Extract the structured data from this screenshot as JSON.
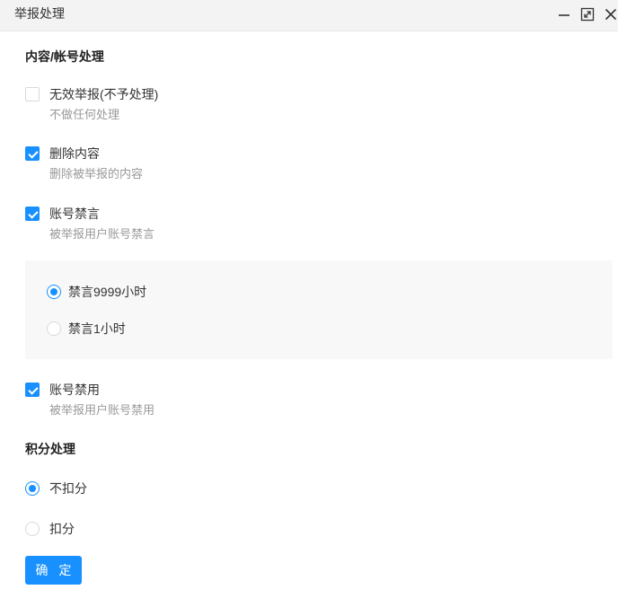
{
  "window": {
    "title": "举报处理",
    "controls": [
      "minimize-icon",
      "maximize-icon",
      "close-icon"
    ]
  },
  "content_section": {
    "title": "内容/帐号处理",
    "options": [
      {
        "label": "无效举报(不予处理)",
        "description": "不做任何处理",
        "checked": false
      },
      {
        "label": "删除内容",
        "description": "删除被举报的内容",
        "checked": true
      },
      {
        "label": "账号禁言",
        "description": "被举报用户账号禁言",
        "checked": true
      },
      {
        "label": "账号禁用",
        "description": "被举报用户账号禁用",
        "checked": true
      }
    ],
    "mute_duration": [
      {
        "label": "禁言9999小时",
        "selected": true
      },
      {
        "label": "禁言1小时",
        "selected": false
      }
    ]
  },
  "points_section": {
    "title": "积分处理",
    "options": [
      {
        "label": "不扣分",
        "selected": true
      },
      {
        "label": "扣分",
        "selected": false
      }
    ]
  },
  "actions": {
    "confirm_label": "确 定"
  },
  "colors": {
    "accent": "#1890ff",
    "titlebar_bg": "#f3f3f3",
    "panel_bg": "#f8f8f8",
    "muted_text": "#999999"
  }
}
